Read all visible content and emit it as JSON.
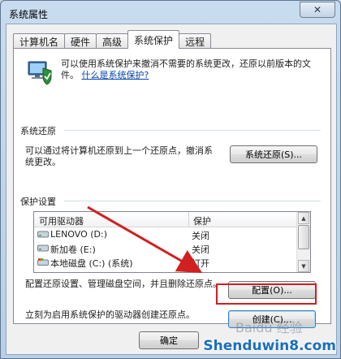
{
  "window": {
    "title": "系统属性",
    "close_symbol": "✕"
  },
  "tabs": [
    {
      "label": "计算机名",
      "active": false
    },
    {
      "label": "硬件",
      "active": false
    },
    {
      "label": "高级",
      "active": false
    },
    {
      "label": "系统保护",
      "active": true
    },
    {
      "label": "远程",
      "active": false
    }
  ],
  "intro": {
    "text": "可以使用系统保护来撤消不需要的系统更改，还原以前版本的文件。",
    "link": "什么是系统保护?"
  },
  "restore": {
    "section_label": "系统还原",
    "description": "可以通过将计算机还原到上一个还原点，撤消系统更改。",
    "button_label": "系统还原(S)..."
  },
  "protection": {
    "section_label": "保护设置",
    "columns": [
      "可用驱动器",
      "保护"
    ],
    "drives": [
      {
        "name": "LENOVO (D:)",
        "status": "关闭",
        "icon": "drive-icon"
      },
      {
        "name": "新加卷 (E:)",
        "status": "关闭",
        "icon": "drive-icon"
      },
      {
        "name": "本地磁盘 (C:) (系统)",
        "status": "打开",
        "icon": "system-drive-icon"
      }
    ],
    "config_description": "配置还原设置、管理磁盘空间，并且删除还原点。",
    "config_button": "配置(O)...",
    "create_description": "立刻为启用系统保护的驱动器创建还原点。",
    "create_button": "创建(C)..."
  },
  "footer": {
    "ok_button": "确定"
  },
  "watermark": {
    "site": "Shenduwin8.com",
    "baidu": "Baidu 经验"
  },
  "colors": {
    "annotation_red": "#d02020",
    "link": "#0645ad"
  }
}
